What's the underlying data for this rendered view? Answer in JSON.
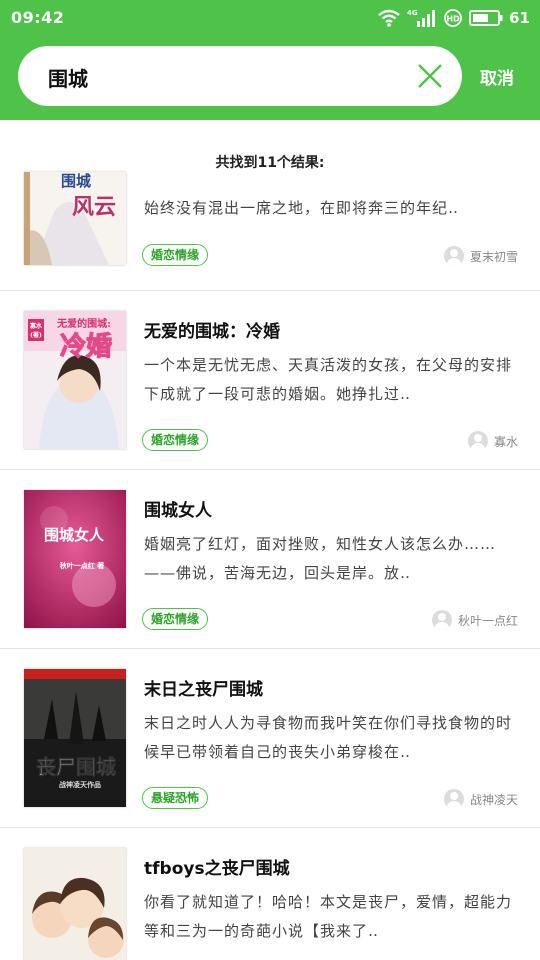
{
  "status_bar": {
    "time": "09:42",
    "network": "4G",
    "hd_badge": "HD",
    "battery": "61",
    "icons": [
      "wifi-icon",
      "signal-icon",
      "hd-icon",
      "battery-icon"
    ]
  },
  "search": {
    "value": "围城",
    "cancel_label": "取消",
    "clear_icon": "close-icon"
  },
  "results": {
    "count_text": "共找到11个结果:"
  },
  "books": [
    {
      "title": "",
      "desc": "始终没有混出一席之地，在即将奔三的年纪‥",
      "tag": "婚恋情缘",
      "author": "夏末初雪",
      "cover_title": "围城风云"
    },
    {
      "title": "无爱的围城：冷婚",
      "desc": "一个本是无忧无虑、天真活泼的女孩，在父母的安排下成就了一段可悲的婚姻。她挣扎过‥",
      "tag": "婚恋情缘",
      "author": "寡水",
      "cover_title": "冷婚",
      "cover_sub": "无爱的围城",
      "cover_author": "寡水"
    },
    {
      "title": "围城女人",
      "desc": "婚姻亮了红灯，面对挫败，知性女人该怎么办……——佛说，苦海无边，回头是岸。放‥",
      "tag": "婚恋情缘",
      "author": "秋叶一点红",
      "cover_title": "围城女人",
      "cover_author": "秋叶一点红 著"
    },
    {
      "title": "末日之丧尸围城",
      "desc": "末日之时人人为寻食物而我叶笑在你们寻找食物的时候早已带领着自己的丧失小弟穿梭在‥",
      "tag": "悬疑恐怖",
      "author": "战神凌天",
      "cover_title": "丧尸围城",
      "cover_author": "战神凌天作品"
    },
    {
      "title": "tfboys之丧尸围城",
      "desc": "你看了就知道了！哈哈！本文是丧尸，爱情，超能力等和三为一的奇葩小说【我来了‥",
      "tag": "",
      "author": "",
      "cover_title": ""
    }
  ],
  "colors": {
    "brand_green": "#4fc24a",
    "tag_green": "#2ea52a"
  }
}
